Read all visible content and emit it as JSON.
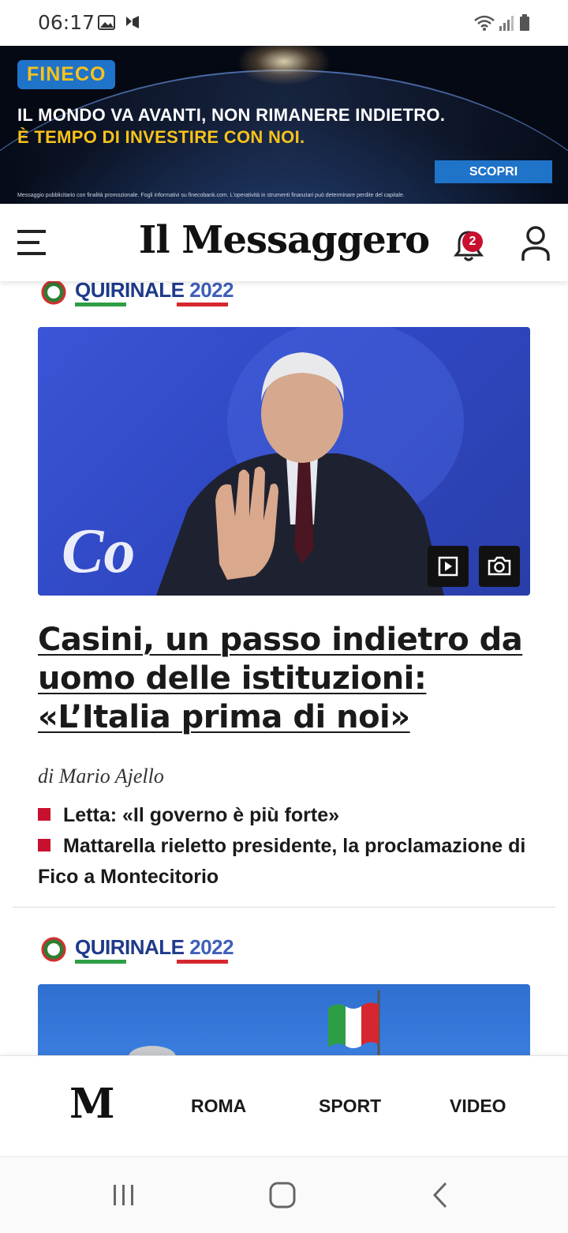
{
  "status_bar": {
    "time": "06:17"
  },
  "ad": {
    "brand": "FINECO",
    "line1": "IL MONDO VA AVANTI, NON RIMANERE INDIETRO.",
    "line2": "È TEMPO DI INVESTIRE CON NOI.",
    "cta": "SCOPRI",
    "disclaimer": "Messaggio pubblicitario con finalità promozionale. Fogli informativi su finecobank.com. L'operatività in strumenti finanziari può determinare perdite del capitale."
  },
  "header": {
    "logo": "Il Messaggero",
    "notification_count": "2"
  },
  "section_tag": {
    "word": "QUIRINALE",
    "year": "2022"
  },
  "article": {
    "headline": "Casini, un passo indietro da uomo delle istituzioni: «L’Italia prima di noi»",
    "byline": "di Mario Ajello",
    "related": [
      "Letta: «Il governo è più forte»",
      "Mattarella rieletto presidente, la proclamazione di Fico a Montecitorio"
    ]
  },
  "bottom_nav": {
    "logo": "M",
    "items": [
      "ROMA",
      "SPORT",
      "VIDEO"
    ]
  },
  "icons": {
    "status": [
      "gallery-icon",
      "app-notification-icon",
      "wifi-icon",
      "signal-icon",
      "battery-icon"
    ],
    "header": [
      "hamburger-menu-icon",
      "bell-icon",
      "user-icon"
    ],
    "media": [
      "play-icon",
      "camera-icon"
    ],
    "system": [
      "recent-apps-icon",
      "home-icon",
      "back-icon"
    ]
  },
  "colors": {
    "brand_red": "#c8102e",
    "fineco_blue": "#1f73c9",
    "fineco_yellow": "#f6c21b",
    "quirinale_blue": "#1e3a8a"
  }
}
